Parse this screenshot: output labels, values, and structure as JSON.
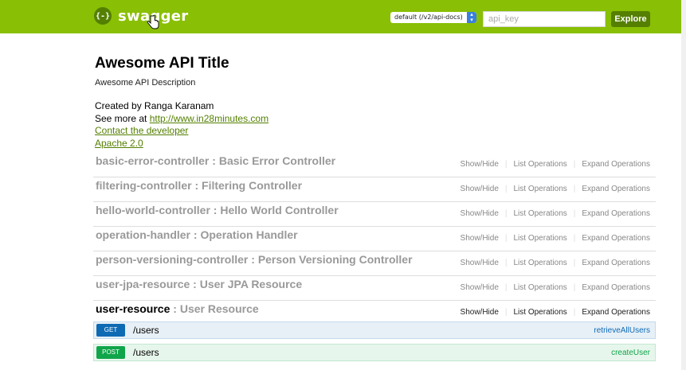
{
  "header": {
    "logo_icon": "{-}",
    "logo_text": "swagger",
    "spec_select": "default (/v2/api-docs)",
    "api_key_placeholder": "api_key",
    "explore_label": "Explore"
  },
  "info": {
    "title": "Awesome API Title",
    "description": "Awesome API Description",
    "created_by": "Created by Ranga Karanam",
    "see_more_prefix": "See more at ",
    "see_more_link": "http://www.in28minutes.com",
    "contact_link": "Contact the developer",
    "license_link": "Apache 2.0"
  },
  "operations_labels": {
    "show_hide": "Show/Hide",
    "list_operations": "List Operations",
    "expand_operations": "Expand Operations"
  },
  "resources": [
    {
      "name": "basic-error-controller",
      "separator": " : ",
      "description": "Basic Error Controller"
    },
    {
      "name": "filtering-controller",
      "separator": " : ",
      "description": "Filtering Controller"
    },
    {
      "name": "hello-world-controller",
      "separator": " : ",
      "description": "Hello World Controller"
    },
    {
      "name": "operation-handler",
      "separator": " : ",
      "description": "Operation Handler"
    },
    {
      "name": "person-versioning-controller",
      "separator": " : ",
      "description": "Person Versioning Controller"
    },
    {
      "name": "user-jpa-resource",
      "separator": " : ",
      "description": "User JPA Resource"
    },
    {
      "name": "user-resource",
      "separator": " : ",
      "description": "User Resource"
    }
  ],
  "endpoints": [
    {
      "method": "GET",
      "path": "/users",
      "operation_id": "retrieveAllUsers"
    },
    {
      "method": "POST",
      "path": "/users",
      "operation_id": "createUser"
    }
  ],
  "colors": {
    "header_green": "#89bf04",
    "dark_green": "#547f00",
    "get_blue": "#0f6ab4",
    "post_green": "#10a54a"
  }
}
